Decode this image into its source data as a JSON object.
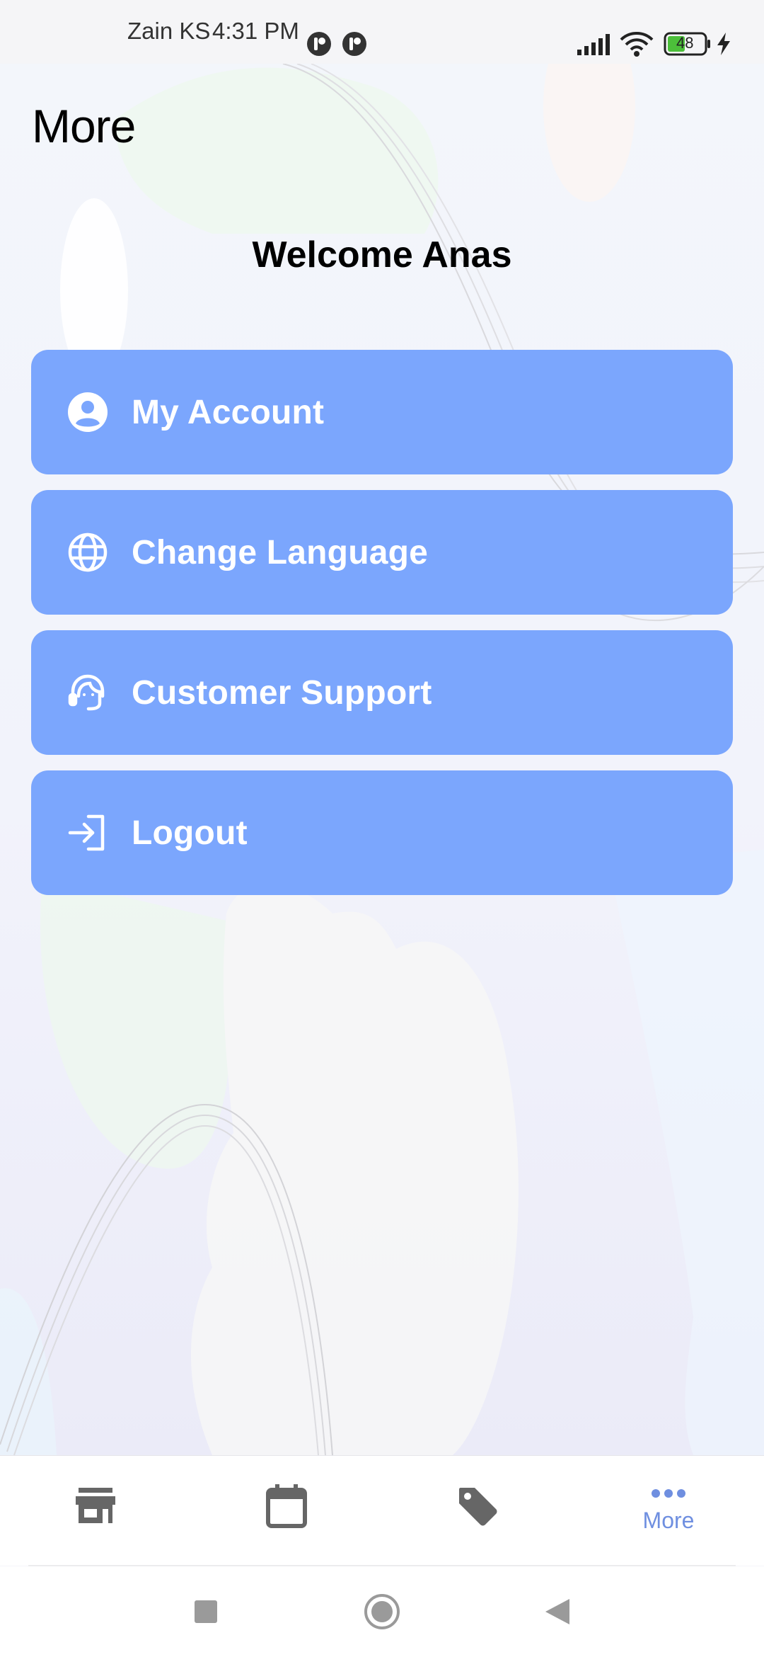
{
  "status_bar": {
    "carrier": "Zain KS",
    "time": "4:31 PM",
    "battery_level": "48",
    "icons": [
      "notification-icon",
      "notification-icon",
      "signal-icon",
      "wifi-icon",
      "battery-icon",
      "charging-icon"
    ]
  },
  "header": {
    "title": "More"
  },
  "welcome": {
    "text": "Welcome Anas"
  },
  "menu": {
    "button_color": "#7ba6fd",
    "items": [
      {
        "label": "My Account",
        "icon": "account-circle-icon"
      },
      {
        "label": "Change Language",
        "icon": "globe-icon"
      },
      {
        "label": "Customer Support",
        "icon": "headset-icon"
      },
      {
        "label": "Logout",
        "icon": "login-arrow-icon"
      }
    ]
  },
  "bottom_nav": {
    "active_color": "#6f8fe0",
    "items": [
      {
        "icon": "store-icon",
        "label": ""
      },
      {
        "icon": "calendar-icon",
        "label": ""
      },
      {
        "icon": "tag-icon",
        "label": ""
      },
      {
        "icon": "more-dots-icon",
        "label": "More",
        "active": true
      }
    ]
  },
  "system_nav": {
    "buttons": [
      "recents-button",
      "home-button",
      "back-button"
    ]
  }
}
